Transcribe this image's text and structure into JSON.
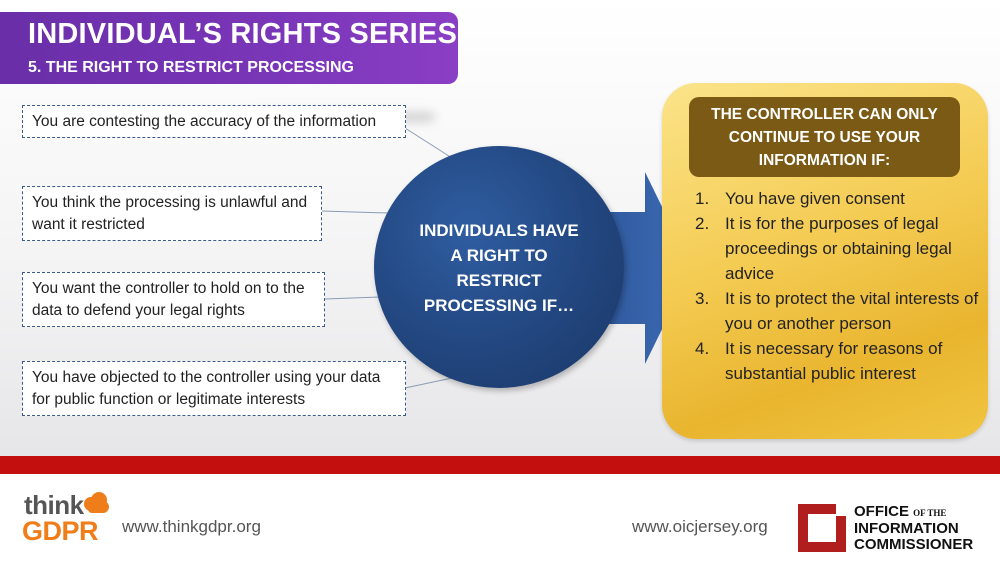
{
  "header": {
    "title": "INDIVIDUAL’S RIGHTS SERIES:",
    "subtitle": "5. THE RIGHT TO RESTRICT PROCESSING"
  },
  "conditions": [
    "You are contesting the accuracy of the information",
    "You think the processing is unlawful and want it restricted",
    "You want the controller to hold on to the data to defend your legal rights",
    "You have objected to the controller using your data for public function or legitimate interests"
  ],
  "center": {
    "text": "INDIVIDUALS HAVE A RIGHT TO RESTRICT PROCESSING IF…"
  },
  "controller": {
    "heading": "THE CONTROLLER CAN ONLY CONTINUE TO USE YOUR INFORMATION IF:",
    "items": [
      {
        "num": "1.",
        "text": "You have given consent"
      },
      {
        "num": "2.",
        "text": "It is for the purposes of legal proceedings or obtaining legal advice"
      },
      {
        "num": "3.",
        "text": "It is to protect the vital interests of you or another person"
      },
      {
        "num": "4.",
        "text": "It is necessary for reasons of substantial public interest"
      }
    ]
  },
  "footer": {
    "think_logo_top": "think",
    "think_logo_bottom": "GDPR",
    "url_left": "www.thinkgdpr.org",
    "url_right": "www.oicjersey.org",
    "oic_line1": "OFFICE",
    "oic_line1_small": "OF THE",
    "oic_line2": "INFORMATION",
    "oic_line3": "COMMISSIONER"
  },
  "colors": {
    "title_purple": "#7a36b8",
    "circle_blue": "#22467f",
    "panel_gold": "#f4cb52",
    "header_brown": "#7a5a14",
    "bar_red": "#c40f0f",
    "gdpr_orange": "#ef7d1a"
  }
}
